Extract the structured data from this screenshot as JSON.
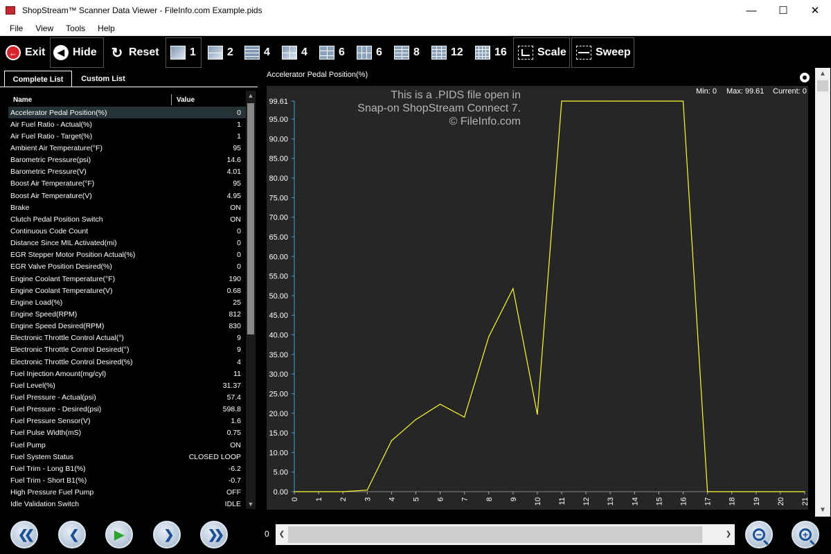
{
  "window": {
    "title": "ShopStream™ Scanner Data Viewer - FileInfo.com Example.pids",
    "minimize": "—",
    "maximize": "☐",
    "close": "✕"
  },
  "menu": {
    "items": [
      "File",
      "View",
      "Tools",
      "Help"
    ]
  },
  "toolbar": {
    "exit": "Exit",
    "hide": "Hide",
    "reset": "Reset",
    "layouts": [
      "1",
      "2",
      "4",
      "4",
      "6",
      "6",
      "8",
      "12",
      "16"
    ],
    "scale": "Scale",
    "sweep": "Sweep"
  },
  "tabs": {
    "complete": "Complete List",
    "custom": "Custom List"
  },
  "list": {
    "header_name": "Name",
    "header_value": "Value",
    "rows": [
      {
        "name": "Accelerator Pedal Position(%)",
        "value": "0"
      },
      {
        "name": "Air Fuel Ratio - Actual(%)",
        "value": "1"
      },
      {
        "name": "Air Fuel Ratio - Target(%)",
        "value": "1"
      },
      {
        "name": "Ambient Air Temperature(°F)",
        "value": "95"
      },
      {
        "name": "Barometric Pressure(psi)",
        "value": "14.6"
      },
      {
        "name": "Barometric Pressure(V)",
        "value": "4.01"
      },
      {
        "name": "Boost Air Temperature(°F)",
        "value": "95"
      },
      {
        "name": "Boost Air Temperature(V)",
        "value": "4.95"
      },
      {
        "name": "Brake",
        "value": "ON"
      },
      {
        "name": "Clutch Pedal Position Switch",
        "value": "ON"
      },
      {
        "name": "Continuous Code Count",
        "value": "0"
      },
      {
        "name": "Distance Since MIL Activated(mi)",
        "value": "0"
      },
      {
        "name": "EGR Stepper Motor Position Actual(%)",
        "value": "0"
      },
      {
        "name": "EGR Valve Position Desired(%)",
        "value": "0"
      },
      {
        "name": "Engine Coolant Temperature(°F)",
        "value": "190"
      },
      {
        "name": "Engine Coolant Temperature(V)",
        "value": "0.68"
      },
      {
        "name": "Engine Load(%)",
        "value": "25"
      },
      {
        "name": "Engine Speed(RPM)",
        "value": "812"
      },
      {
        "name": "Engine Speed Desired(RPM)",
        "value": "830"
      },
      {
        "name": "Electronic Throttle Control Actual(°)",
        "value": "9"
      },
      {
        "name": "Electronic Throttle Control Desired(°)",
        "value": "9"
      },
      {
        "name": "Electronic Throttle Control Desired(%)",
        "value": "4"
      },
      {
        "name": "Fuel Injection Amount(mg/cyl)",
        "value": "11"
      },
      {
        "name": "Fuel Level(%)",
        "value": "31.37"
      },
      {
        "name": "Fuel Pressure - Actual(psi)",
        "value": "57.4"
      },
      {
        "name": "Fuel Pressure - Desired(psi)",
        "value": "598.8"
      },
      {
        "name": "Fuel Pressure Sensor(V)",
        "value": "1.6"
      },
      {
        "name": "Fuel Pulse Width(mS)",
        "value": "0.75"
      },
      {
        "name": "Fuel Pump",
        "value": "ON"
      },
      {
        "name": "Fuel System Status",
        "value": "CLOSED LOOP"
      },
      {
        "name": "Fuel Trim - Long B1(%)",
        "value": "-6.2"
      },
      {
        "name": "Fuel Trim - Short B1(%)",
        "value": "-0.7"
      },
      {
        "name": "High Pressure Fuel Pump",
        "value": "OFF"
      },
      {
        "name": "Idle Validation Switch",
        "value": "IDLE"
      }
    ]
  },
  "graph": {
    "title": "Accelerator Pedal Position(%)",
    "min_label": "Min: 0",
    "max_label": "Max: 99.61",
    "current_label": "Current: 0",
    "watermark": [
      "This is a .PIDS file open in",
      "Snap-on ShopStream Connect 7.",
      "© FileInfo.com"
    ]
  },
  "chart_data": {
    "type": "line",
    "title": "Accelerator Pedal Position(%)",
    "xlabel": "",
    "ylabel": "",
    "xlim": [
      0,
      21
    ],
    "ylim": [
      0,
      99.61
    ],
    "yticks": [
      "99.61",
      "95.00",
      "90.00",
      "85.00",
      "80.00",
      "75.00",
      "70.00",
      "65.00",
      "60.00",
      "55.00",
      "50.00",
      "45.00",
      "40.00",
      "35.00",
      "30.00",
      "25.00",
      "20.00",
      "15.00",
      "10.00",
      "5.00",
      "0.00"
    ],
    "xticks": [
      "0",
      "1",
      "2",
      "3",
      "4",
      "5",
      "6",
      "7",
      "8",
      "9",
      "10",
      "11",
      "12",
      "13",
      "14",
      "15",
      "16",
      "17",
      "18",
      "19",
      "20",
      "21"
    ],
    "line_color": "#ffff33",
    "series": [
      {
        "x": [
          0,
          1,
          2,
          3,
          4,
          5,
          6,
          7,
          8,
          9,
          10,
          11,
          12,
          13,
          14,
          15,
          16,
          17,
          18,
          19,
          20,
          21
        ],
        "y": [
          0,
          0,
          0,
          0.4,
          13,
          18.4,
          22.3,
          19,
          39.5,
          51.8,
          19.7,
          99.61,
          99.61,
          99.61,
          99.61,
          99.61,
          99.61,
          0,
          0,
          0,
          0,
          0
        ]
      }
    ],
    "grid": false
  },
  "bottom": {
    "position": "0"
  }
}
